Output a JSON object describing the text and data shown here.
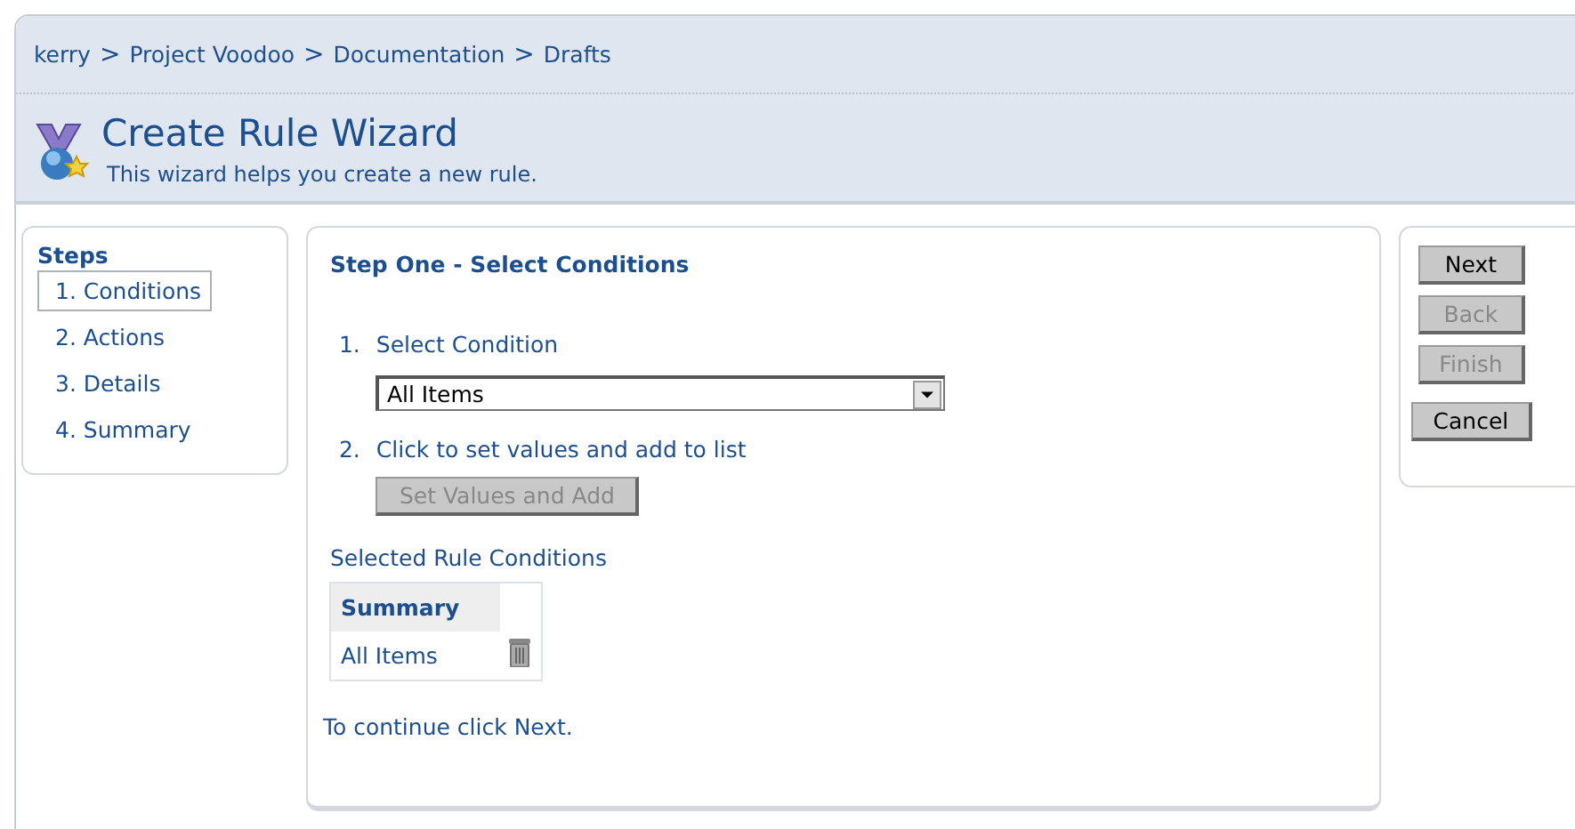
{
  "breadcrumb": [
    {
      "kind": "link",
      "text": "kerry"
    },
    {
      "kind": "separator",
      "text": ">"
    },
    {
      "kind": "link",
      "text": "Project Voodoo"
    },
    {
      "kind": "separator",
      "text": ">"
    },
    {
      "kind": "link",
      "text": "Documentation"
    },
    {
      "kind": "separator",
      "text": ">"
    },
    {
      "kind": "link",
      "text": "Drafts"
    }
  ],
  "header": {
    "title": "Create Rule Wizard",
    "subtitle": "This wizard helps you create a new rule."
  },
  "steps": {
    "title": "Steps",
    "items": [
      {
        "label": "1. Conditions",
        "selected": true
      },
      {
        "label": "2. Actions",
        "selected": false
      },
      {
        "label": "3. Details",
        "selected": false
      },
      {
        "label": "4. Summary",
        "selected": false
      }
    ]
  },
  "main": {
    "title": "Step One - Select Conditions",
    "step_1": {
      "number": "1.",
      "label": "Select Condition",
      "value": "All Items"
    },
    "step_2": {
      "number": "2.",
      "label": "Click to set values and add to list",
      "button": "Set Values and Add",
      "button_disabled": true
    },
    "selected_label": "Selected Rule Conditions",
    "table": {
      "columns": [
        "Summary"
      ],
      "rows": [
        {
          "summary": "All Items"
        }
      ]
    },
    "footer": "To continue click Next."
  },
  "buttons": [
    {
      "label": "Next",
      "disabled": false
    },
    {
      "label": "Back",
      "disabled": true
    },
    {
      "label": "Finish",
      "disabled": true
    },
    {
      "label": "Cancel",
      "disabled": false
    }
  ]
}
